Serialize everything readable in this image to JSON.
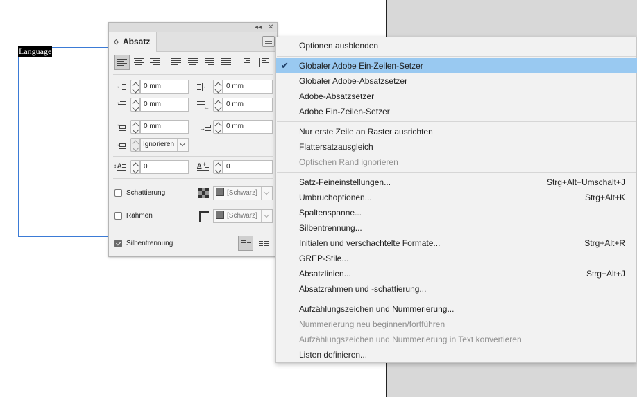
{
  "canvas": {
    "frame_text": "Language"
  },
  "panel": {
    "title": "Absatz",
    "indents": {
      "left": "0 mm",
      "right": "0 mm",
      "first_line": "0 mm",
      "last_line": "0 mm",
      "space_before": "0 mm",
      "space_after": "0 mm",
      "drop_cap_lines": "0",
      "drop_cap_chars": "0"
    },
    "align_to_grid": "Ignorieren",
    "shading_label": "Schattierung",
    "shading_color": "[Schwarz]",
    "border_label": "Rahmen",
    "border_color": "[Schwarz]",
    "hyphenation_label": "Silbentrennung"
  },
  "menu": {
    "items": [
      {
        "label": "Optionen ausblenden",
        "shortcut": ""
      },
      {
        "label": "Globaler Adobe Ein-Zeilen-Setzer",
        "shortcut": ""
      },
      {
        "label": "Globaler Adobe-Absatzsetzer",
        "shortcut": ""
      },
      {
        "label": "Adobe-Absatzsetzer",
        "shortcut": ""
      },
      {
        "label": "Adobe Ein-Zeilen-Setzer",
        "shortcut": ""
      },
      {
        "label": "Nur erste Zeile an Raster ausrichten",
        "shortcut": ""
      },
      {
        "label": "Flattersatzausgleich",
        "shortcut": ""
      },
      {
        "label": "Optischen Rand ignorieren",
        "shortcut": ""
      },
      {
        "label": "Satz-Feineinstellungen...",
        "shortcut": "Strg+Alt+Umschalt+J"
      },
      {
        "label": "Umbruchoptionen...",
        "shortcut": "Strg+Alt+K"
      },
      {
        "label": "Spaltenspanne...",
        "shortcut": ""
      },
      {
        "label": "Silbentrennung...",
        "shortcut": ""
      },
      {
        "label": "Initialen und verschachtelte Formate...",
        "shortcut": "Strg+Alt+R"
      },
      {
        "label": "GREP-Stile...",
        "shortcut": ""
      },
      {
        "label": "Absatzlinien...",
        "shortcut": "Strg+Alt+J"
      },
      {
        "label": "Absatzrahmen und -schattierung...",
        "shortcut": ""
      },
      {
        "label": "Aufzählungszeichen und Nummerierung...",
        "shortcut": ""
      },
      {
        "label": "Nummerierung neu beginnen/fortführen",
        "shortcut": ""
      },
      {
        "label": "Aufzählungszeichen und Nummerierung in Text konvertieren",
        "shortcut": ""
      },
      {
        "label": "Listen definieren...",
        "shortcut": ""
      }
    ]
  },
  "colors": {
    "highlight": "#99c9f1",
    "frame_border": "#3b7bd6",
    "margin_guide": "#9b46c8"
  }
}
